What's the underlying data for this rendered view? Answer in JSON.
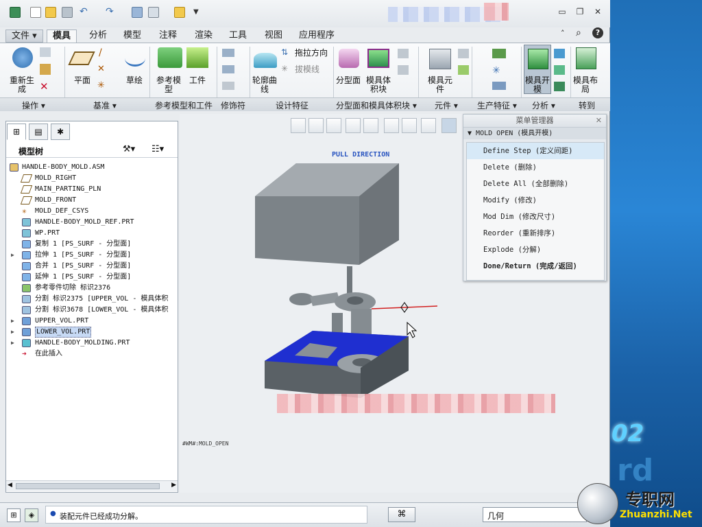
{
  "tabs": [
    "文件",
    "模具",
    "分析",
    "模型",
    "注释",
    "渲染",
    "工具",
    "视图",
    "应用程序"
  ],
  "ribbon": {
    "regen": "重新生成",
    "plane": "平面",
    "sketch": "草绘",
    "ref_model": "参考模型",
    "workpiece": "工件",
    "contour": "轮廓曲线",
    "drag_dir": "拖拉方向",
    "draft_line": "拔模线",
    "parting_surf": "分型面",
    "mold_volume": "模具体积块",
    "mold_comp": "模具元件",
    "mold_open": "模具开模",
    "mold_layout": "模具布局"
  },
  "groups": [
    "操作",
    "基准",
    "参考模型和工件",
    "修饰符",
    "设计特征",
    "分型面和模具体积块",
    "元件",
    "生产特征",
    "分析",
    "转到"
  ],
  "tree": {
    "title": "模型树",
    "items": [
      {
        "label": "HANDLE-BODY_MOLD.ASM",
        "icon": "assembly-icon",
        "expand": ""
      },
      {
        "label": "MOLD_RIGHT",
        "icon": "datum-plane-icon",
        "expand": ""
      },
      {
        "label": "MAIN_PARTING_PLN",
        "icon": "datum-plane-icon",
        "expand": ""
      },
      {
        "label": "MOLD_FRONT",
        "icon": "datum-plane-icon",
        "expand": ""
      },
      {
        "label": "MOLD_DEF_CSYS",
        "icon": "csys-icon",
        "expand": ""
      },
      {
        "label": "HANDLE-BODY_MOLD_REF.PRT",
        "icon": "part-icon",
        "expand": ""
      },
      {
        "label": "WP.PRT",
        "icon": "part-icon",
        "expand": ""
      },
      {
        "label": "复制 1 [PS_SURF - 分型面]",
        "icon": "surface-icon",
        "expand": ""
      },
      {
        "label": "拉伸 1 [PS_SURF - 分型面]",
        "icon": "surface-icon",
        "expand": "▶"
      },
      {
        "label": "合并 1 [PS_SURF - 分型面]",
        "icon": "surface-icon",
        "expand": ""
      },
      {
        "label": "延伸 1 [PS_SURF - 分型面]",
        "icon": "surface-icon",
        "expand": ""
      },
      {
        "label": "参考零件切除 标识2376",
        "icon": "cut-icon",
        "expand": ""
      },
      {
        "label": "分割 标识2375 [UPPER_VOL - 模具体积",
        "icon": "split-icon",
        "expand": ""
      },
      {
        "label": "分割 标识3678 [LOWER_VOL - 模具体积",
        "icon": "split-icon",
        "expand": ""
      },
      {
        "label": "UPPER_VOL.PRT",
        "icon": "volume-icon",
        "expand": "▶"
      },
      {
        "label": "LOWER_VOL.PRT",
        "icon": "volume-icon",
        "expand": "▶"
      },
      {
        "label": "HANDLE-BODY_MOLDING.PRT",
        "icon": "molding-icon",
        "expand": "▶"
      },
      {
        "label": "在此插入",
        "icon": "insert-arrow-icon",
        "expand": ""
      }
    ]
  },
  "view": {
    "pull_direction": "PULL DIRECTION",
    "note": "#WM#:MOLD_OPEN"
  },
  "menu": {
    "title": "菜单管理器",
    "sub": "MOLD OPEN (模具开模)",
    "items": [
      "Define Step (定义间距)",
      "Delete (删除)",
      "Delete All (全部删除)",
      "Modify (修改)",
      "Mod Dim (修改尺寸)",
      "Reorder (重新排序)",
      "Explode (分解)",
      "Done/Return (完成/返回)"
    ]
  },
  "status": {
    "message": "装配元件已经成功分解。",
    "filter": "几何"
  },
  "desktop": {
    "text": "02",
    "watermark_cn": "专职网",
    "watermark_en": "Zhuanzhi.Net"
  }
}
